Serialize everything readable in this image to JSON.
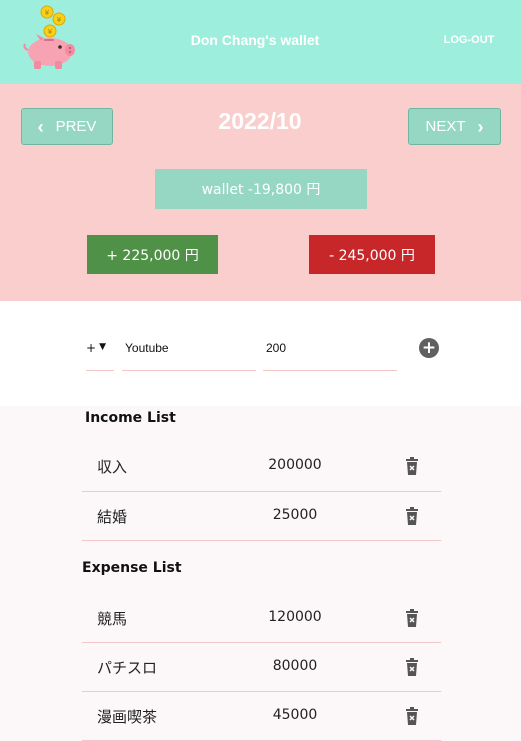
{
  "header": {
    "title": "Don Chang's wallet",
    "logout_label": "LOG-OUT",
    "logo_icon": "piggy-bank-icon",
    "bg_color": "#9eeede"
  },
  "month": {
    "prev_label": "PREV",
    "next_label": "NEXT",
    "title": "2022/10",
    "wallet_text": "wallet -19,800 円",
    "income_total": "+ 225,000 円",
    "expense_total": "- 245,000 円",
    "bg_color": "#f9cecc",
    "income_color": "#4f9147",
    "expense_color": "#c8272a"
  },
  "form": {
    "type_value": "+",
    "name_value": "Youtube",
    "amount_value": "200",
    "add_icon": "plus-circle-icon"
  },
  "income": {
    "title": "Income List",
    "items": [
      {
        "name": "収入",
        "amount": "200000"
      },
      {
        "name": "結婚",
        "amount": "25000"
      }
    ]
  },
  "expense": {
    "title": "Expense List",
    "items": [
      {
        "name": "競馬",
        "amount": "120000"
      },
      {
        "name": "パチスロ",
        "amount": "80000"
      },
      {
        "name": "漫画喫茶",
        "amount": "45000"
      }
    ]
  }
}
